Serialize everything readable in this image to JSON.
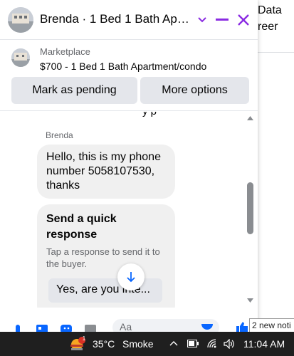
{
  "background": {
    "right_lines": [
      "Data",
      "reer"
    ]
  },
  "chat": {
    "title": "Brenda · 1 Bed 1 Bath Apar...",
    "accent_color": "#8a2be2",
    "listing": {
      "label": "Marketplace",
      "title": "$700 - 1 Bed 1 Bath Apartment/condo"
    },
    "buttons": {
      "mark_pending": "Mark as pending",
      "more_options": "More options"
    },
    "messages": {
      "clipped_top": "y p",
      "sender": "Brenda",
      "bubble_text": "Hello, this is my phone number 5058107530, thanks"
    },
    "quick_response": {
      "title": "Send a quick response",
      "subtitle": "Tap a response to send it to the buyer.",
      "option": "Yes, are you inte..."
    },
    "composer": {
      "placeholder": "Aa"
    }
  },
  "toast": {
    "text": "2 new noti"
  },
  "taskbar": {
    "weather_badge": "1",
    "temperature": "35°C",
    "weather_text": "Smoke",
    "time": "11:04 AM"
  }
}
